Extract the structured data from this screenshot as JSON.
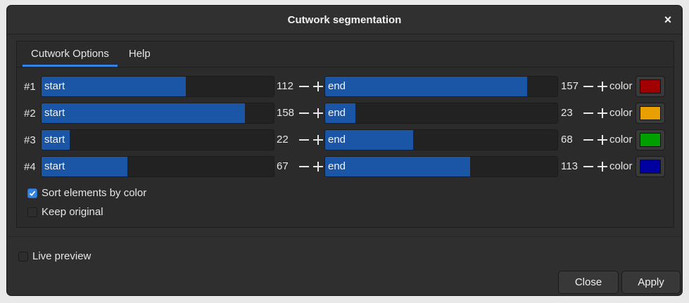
{
  "window": {
    "title": "Cutwork segmentation",
    "close_glyph": "×"
  },
  "tabs": [
    {
      "label": "Cutwork Options"
    },
    {
      "label": "Help"
    }
  ],
  "rows": [
    {
      "label": "#1",
      "start_label": "start",
      "start": 112,
      "start_fraction": 0.62,
      "end_label": "end",
      "end": 157,
      "end_fraction": 0.87,
      "color_label": "color",
      "color": "#a00000"
    },
    {
      "label": "#2",
      "start_label": "start",
      "start": 158,
      "start_fraction": 0.875,
      "end_label": "end",
      "end": 23,
      "end_fraction": 0.13,
      "color_label": "color",
      "color": "#e8a000"
    },
    {
      "label": "#3",
      "start_label": "start",
      "start": 22,
      "start_fraction": 0.12,
      "end_label": "end",
      "end": 68,
      "end_fraction": 0.38,
      "color_label": "color",
      "color": "#00a000"
    },
    {
      "label": "#4",
      "start_label": "start",
      "start": 67,
      "start_fraction": 0.37,
      "end_label": "end",
      "end": 113,
      "end_fraction": 0.625,
      "color_label": "color",
      "color": "#0000a0"
    }
  ],
  "options": {
    "sort_by_color": {
      "label": "Sort elements by color",
      "checked": true
    },
    "keep_original": {
      "label": "Keep original",
      "checked": false
    }
  },
  "live_preview": {
    "label": "Live preview",
    "checked": false
  },
  "buttons": {
    "close": "Close",
    "apply": "Apply"
  }
}
